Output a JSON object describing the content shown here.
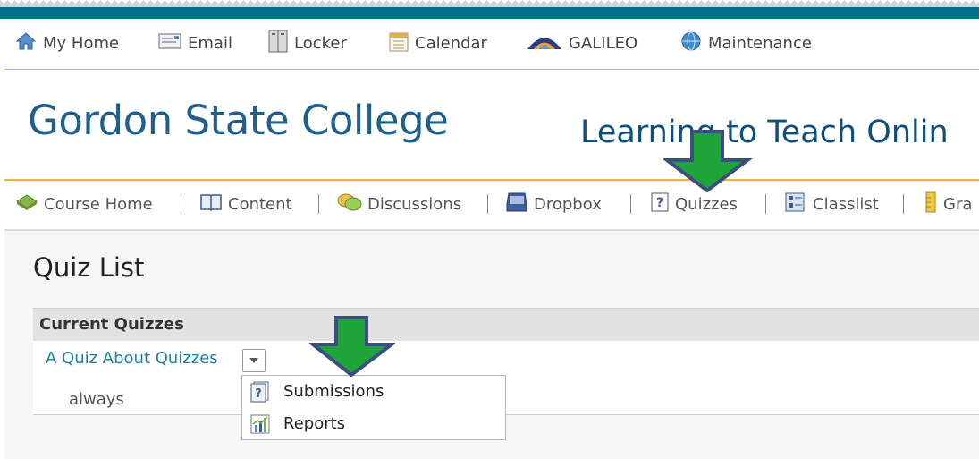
{
  "minibar": {
    "items": [
      {
        "label": "My Home",
        "icon": "house-icon"
      },
      {
        "label": "Email",
        "icon": "email-icon"
      },
      {
        "label": "Locker",
        "icon": "locker-icon"
      },
      {
        "label": "Calendar",
        "icon": "calendar-icon"
      },
      {
        "label": "GALILEO",
        "icon": "galileo-icon"
      },
      {
        "label": "Maintenance",
        "icon": "globe-icon"
      }
    ]
  },
  "header": {
    "college_name": "Gordon State College",
    "course_title": "Learning to Teach Onlin"
  },
  "navbar": {
    "items": [
      {
        "label": "Course Home",
        "icon": "course-home-icon"
      },
      {
        "label": "Content",
        "icon": "book-icon"
      },
      {
        "label": "Discussions",
        "icon": "discussion-icon"
      },
      {
        "label": "Dropbox",
        "icon": "dropbox-icon"
      },
      {
        "label": "Quizzes",
        "icon": "quiz-icon"
      },
      {
        "label": "Classlist",
        "icon": "classlist-icon"
      },
      {
        "label": "Gra",
        "icon": "grades-icon"
      }
    ]
  },
  "main": {
    "page_title": "Quiz List",
    "table_header": "Current Quizzes",
    "quiz": {
      "name": "A Quiz About Quizzes",
      "availability": "always"
    }
  },
  "context_menu": {
    "items": [
      {
        "label": "Submissions",
        "icon": "submissions-icon"
      },
      {
        "label": "Reports",
        "icon": "reports-icon"
      }
    ]
  },
  "colors": {
    "topbar": "#006f8a",
    "accent_line": "#f0b43c",
    "link": "#1f7ea1",
    "arrow_fill": "#1fa437",
    "arrow_stroke": "#3a4e82"
  }
}
